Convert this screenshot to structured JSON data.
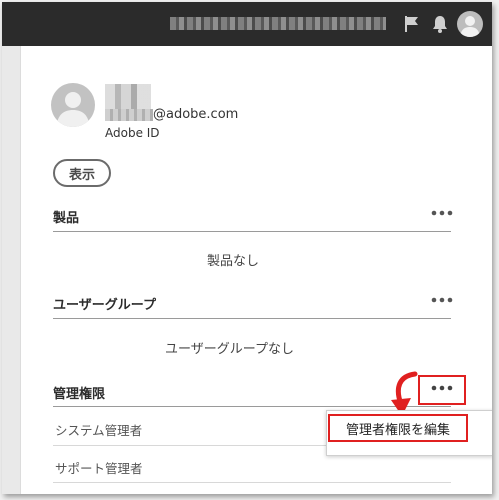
{
  "profile": {
    "email_suffix": "@adobe.com",
    "id_label": "Adobe ID"
  },
  "actions": {
    "view_label": "表示"
  },
  "sections": {
    "products": {
      "title": "製品",
      "empty": "製品なし"
    },
    "user_groups": {
      "title": "ユーザーグループ",
      "empty": "ユーザーグループなし"
    },
    "admin_roles": {
      "title": "管理権限",
      "roles": [
        "システム管理者",
        "サポート管理者"
      ]
    }
  },
  "menu": {
    "edit_admin_label": "管理者権限を編集"
  },
  "icons": {
    "flag": "flag-icon",
    "bell": "bell-icon",
    "user": "user-avatar-icon",
    "more": "more-options-icon",
    "arrow": "curved-arrow-icon"
  },
  "colors": {
    "topbar": "#2b2b2b",
    "highlight": "#e02020"
  }
}
